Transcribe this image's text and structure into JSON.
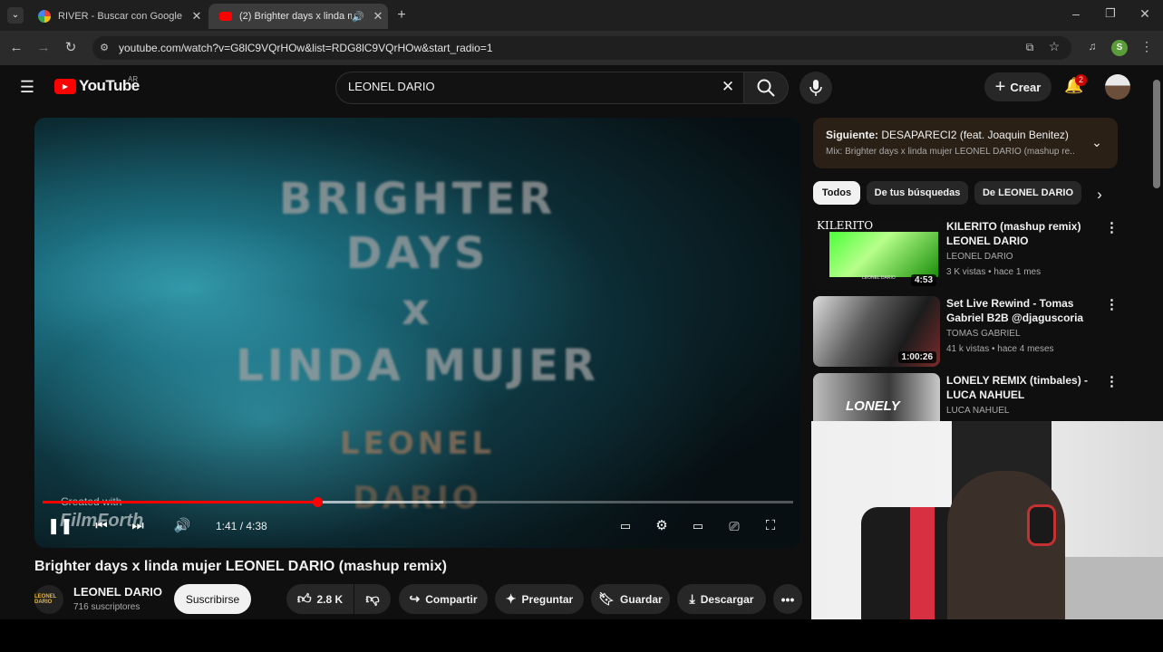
{
  "browser": {
    "tabs": [
      {
        "title": "RIVER - Buscar con Google",
        "active": false
      },
      {
        "title": "(2) Brighter days x linda mu",
        "active": true
      }
    ],
    "url": "youtube.com/watch?v=G8lC9VQrHOw&list=RDG8lC9VQrHOw&start_radio=1",
    "profile_initial": "S"
  },
  "header": {
    "logo": "YouTube",
    "region": "AR",
    "search_value": "LEONEL DARIO",
    "create_label": "Crear",
    "notifications": "2"
  },
  "player": {
    "overlay_lines": [
      "BRIGHTER",
      "DAYS",
      "x",
      "LINDA MUJER",
      "LEONEL",
      "DARIO"
    ],
    "watermark_top": "Created with",
    "watermark_brand": "FilmForth",
    "time": "1:41 / 4:38",
    "progress": 0.366,
    "buffered": 0.534
  },
  "video": {
    "title": "Brighter days x linda mujer LEONEL DARIO (mashup remix)",
    "channel_avatar": "LEONEL DARIO",
    "channel": "LEONEL DARIO",
    "subscribers": "716 suscriptores",
    "subscribe_label": "Suscribirse",
    "likes": "2.8 K",
    "share_label": "Compartir",
    "ask_label": "Preguntar",
    "save_label": "Guardar",
    "download_label": "Descargar"
  },
  "sidebar": {
    "next_label": "Siguiente:",
    "next_title": "DESAPARECI2 (feat. Joaquin Benitez)",
    "next_sub": "Mix: Brighter days x linda mujer LEONEL DARIO (mashup re...",
    "chips": [
      "Todos",
      "De tus búsquedas",
      "De LEONEL DARIO"
    ],
    "related": [
      {
        "title": "KILERITO (mashup remix) LEONEL DARIO",
        "channel": "LEONEL DARIO",
        "meta": "3 K vistas • hace 1 mes",
        "duration": "4:53",
        "thumb_text": "KILERITO",
        "thumb_sub": "LEONEL DARIO"
      },
      {
        "title": "Set Live Rewind - Tomas Gabriel B2B @djaguscoria",
        "channel": "TOMAS GABRIEL",
        "meta": "41 k vistas • hace 4 meses",
        "duration": "1:00:26"
      },
      {
        "title": "LONELY REMIX (timbales) - LUCA NAHUEL",
        "channel": "LUCA NAHUEL",
        "thumb_text": "LONELY"
      }
    ]
  },
  "colors": {
    "accent": "#ff0000",
    "background": "#0f0f0f",
    "chip_active": "#f1f1f1"
  }
}
